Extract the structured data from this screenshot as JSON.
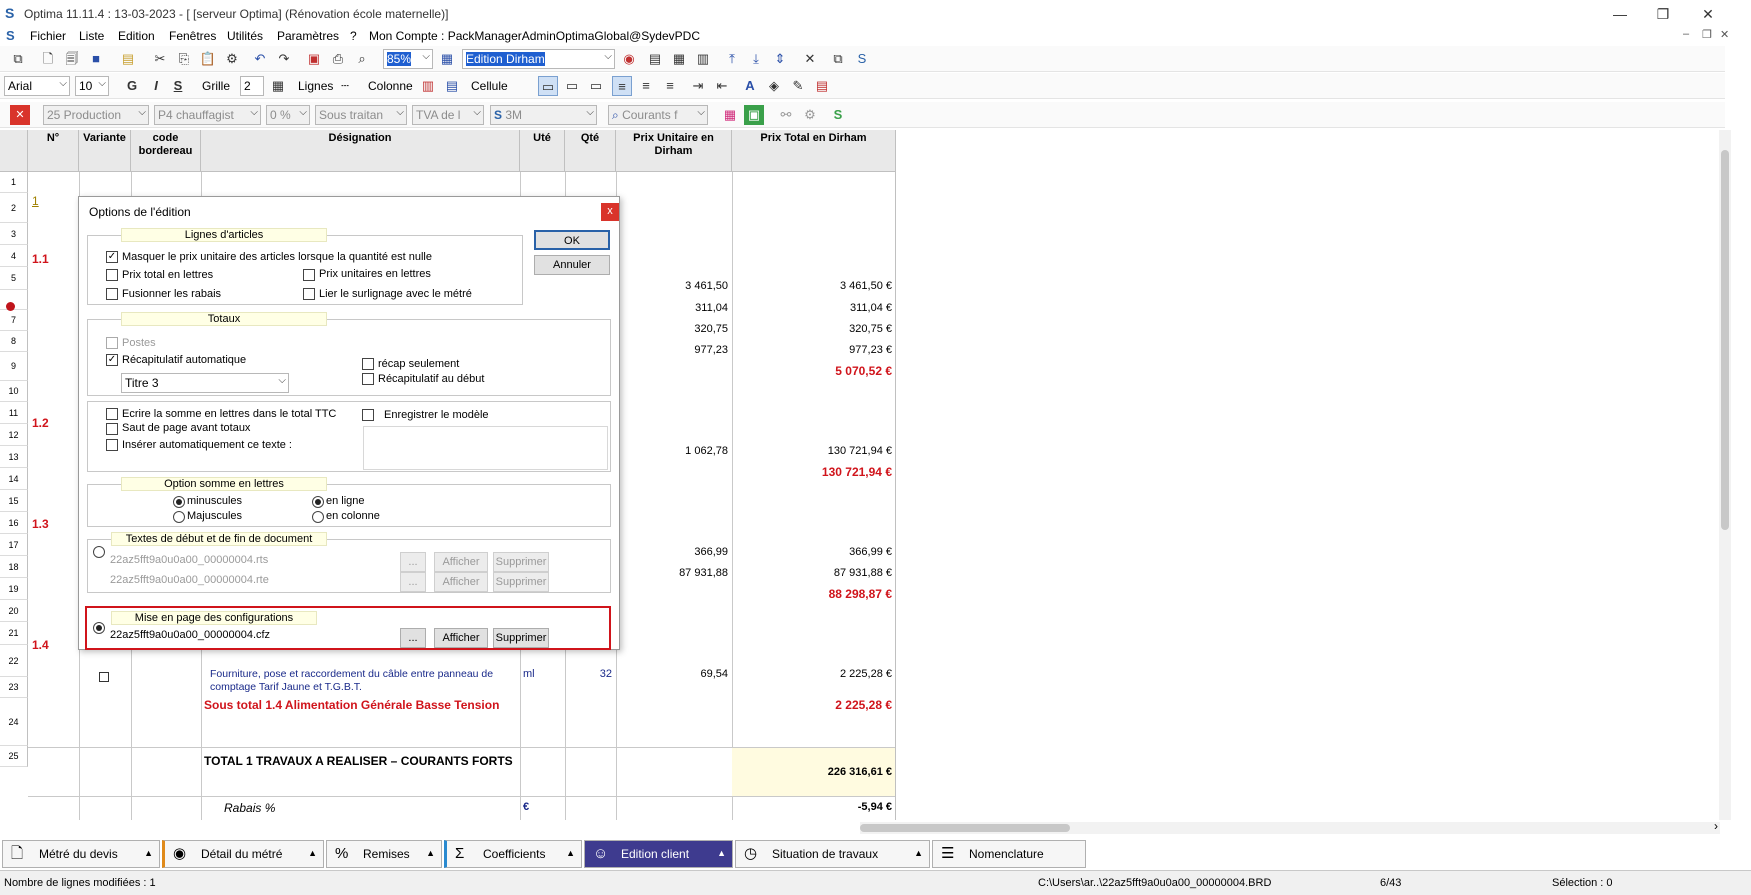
{
  "window": {
    "title": "Optima 11.11.4 : 13-03-2023 - [ [serveur Optima] (Rénovation école maternelle)]",
    "minimize": "—",
    "restore": "❐",
    "close": "✕"
  },
  "menu": {
    "items": [
      "Fichier",
      "Liste",
      "Edition",
      "Fenêtres",
      "Utilités",
      "Paramètres",
      "?",
      "Mon Compte : PackManagerAdminOptimaGlobal@SydevPDC"
    ]
  },
  "toolbar1": {
    "zoom": "85%",
    "edition_select": "Edition Dirham"
  },
  "toolbar2": {
    "font": "Arial",
    "size": "10",
    "bold": "G",
    "italic": "I",
    "strike": "S",
    "grid_label": "Grille",
    "grid_value": "2",
    "lines_label": "Lignes",
    "column_label": "Colonne",
    "cell_label": "Cellule"
  },
  "toolbar3": {
    "c1": "25  Production",
    "c2": "P4  chauffagist",
    "c3": "0 %",
    "c4": "Sous traitan",
    "c5": "TVA de l",
    "c6": "3M",
    "c7": "Courants f"
  },
  "grid": {
    "headers": {
      "num": "N°",
      "variante": "Variante",
      "code": "code bordereau",
      "designation": "Désignation",
      "ute": "Uté",
      "qte": "Qté",
      "pu": "Prix Unitaire en Dirham",
      "pt": "Prix Total en Dirham"
    },
    "rows": [
      "1",
      "2",
      "3",
      "4",
      "5",
      "",
      "7",
      "8",
      "9",
      "10",
      "11",
      "12",
      "13",
      "14",
      "15",
      "16",
      "17",
      "18",
      "19",
      "20",
      "21",
      "22",
      "23",
      "24",
      "25"
    ],
    "sections": [
      "1",
      "1.1",
      "1.2",
      "1.3",
      "1.4"
    ],
    "pu_values": [
      "3 461,50",
      "311,04",
      "320,75",
      "977,23",
      "1 062,78",
      "366,99",
      "87 931,88",
      "69,54"
    ],
    "pt_values": [
      "3 461,50 €",
      "311,04 €",
      "320,75 €",
      "977,23 €",
      "130 721,94 €",
      "366,99 €",
      "87 931,88 €",
      "2 225,28 €"
    ],
    "subtotals": [
      "5 070,52 €",
      "130 721,94 €",
      "88 298,87 €",
      "2 225,28 €"
    ],
    "row21": {
      "designation": "Fourniture, pose et raccordement du câble entre panneau de comptage Tarif Jaune et T.G.B.T.",
      "ute": "ml",
      "qte": "32"
    },
    "row22": "Sous total 1.4 Alimentation Générale Basse Tension",
    "row24": {
      "label": "TOTAL 1 TRAVAUX A REALISER – COURANTS FORTS",
      "value": "226 316,61 €"
    },
    "row25": {
      "label": "Rabais %",
      "unit": "€",
      "value": "-5,94 €"
    }
  },
  "dialog": {
    "title": "Options de l'édition",
    "close": "x",
    "ok": "OK",
    "cancel": "Annuler",
    "lignes": {
      "label": "Lignes d'articles",
      "masquer": "Masquer le prix unitaire des articles lorsque la quantité est nulle",
      "prix_total_lettres": "Prix total en lettres",
      "prix_unitaires_lettres": "Prix unitaires en lettres",
      "fusionner": "Fusionner les rabais",
      "lier": "Lier le surlignage avec le métré"
    },
    "totaux": {
      "label": "Totaux",
      "postes": "Postes",
      "recap_auto": "Récapitulatif automatique",
      "titre": "Titre 3",
      "recap_seul": "récap seulement",
      "recap_debut": "Récapitulatif au début"
    },
    "misc": {
      "ecrire": "Ecrire la somme en lettres dans le total TTC",
      "saut": "Saut de page avant totaux",
      "inserer": "Insérer automatiquement ce texte :",
      "enregistrer": "Enregistrer le modèle"
    },
    "somme": {
      "label": "Option somme en lettres",
      "minuscules": "minuscules",
      "majuscules": "Majuscules",
      "en_ligne": "en ligne",
      "en_colonne": "en colonne"
    },
    "textes": {
      "label": "Textes de début et de fin de document",
      "file1": "22az5fft9a0u0a00_00000004.rts",
      "file2": "22az5fft9a0u0a00_00000004.rte",
      "dots": "...",
      "afficher": "Afficher",
      "supprimer": "Supprimer"
    },
    "mise": {
      "label": "Mise en page des configurations",
      "file": "22az5fft9a0u0a00_00000004.cfz",
      "dots": "...",
      "afficher": "Afficher",
      "supprimer": "Supprimer"
    }
  },
  "tabs": [
    "Métré du devis",
    "Détail du métré",
    "Remises",
    "Coefficients",
    "Edition client",
    "Situation de travaux",
    "Nomenclature"
  ],
  "status": {
    "modified": "Nombre de lignes modifiées : 1",
    "path": "C:\\Users\\ar..\\22az5fft9a0u0a00_00000004.BRD",
    "page": "6/43",
    "selection": "Sélection : 0"
  },
  "colors": {
    "accent": "#3e3b8f",
    "red": "#d0141b",
    "highlight": "#d0141b"
  }
}
